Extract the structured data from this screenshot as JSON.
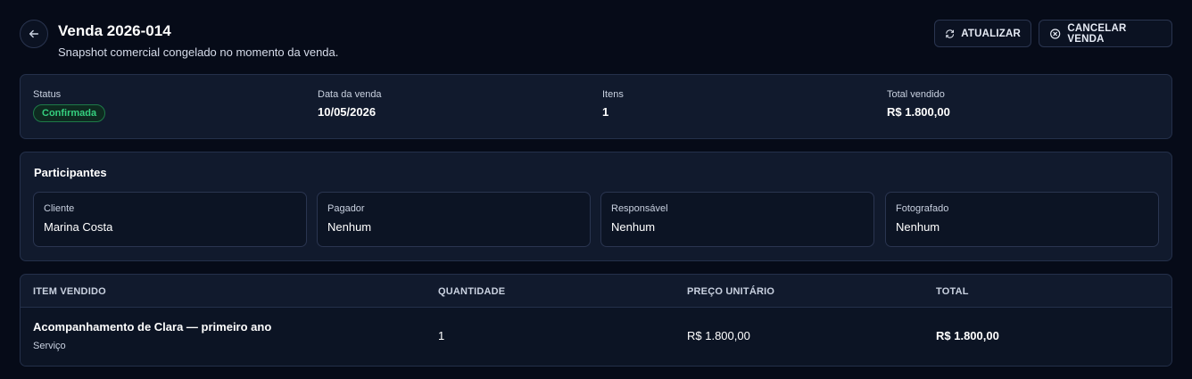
{
  "header": {
    "title": "Venda 2026-014",
    "subtitle": "Snapshot comercial congelado no momento da venda.",
    "refresh_label": "ATUALIZAR",
    "cancel_label": "CANCELAR VENDA"
  },
  "summary": {
    "status_label": "Status",
    "status_value": "Confirmada",
    "date_label": "Data da venda",
    "date_value": "10/05/2026",
    "items_label": "Itens",
    "items_value": "1",
    "total_label": "Total vendido",
    "total_value": "R$ 1.800,00"
  },
  "participants": {
    "title": "Participantes",
    "items": [
      {
        "label": "Cliente",
        "value": "Marina Costa"
      },
      {
        "label": "Pagador",
        "value": "Nenhum"
      },
      {
        "label": "Responsável",
        "value": "Nenhum"
      },
      {
        "label": "Fotografado",
        "value": "Nenhum"
      }
    ]
  },
  "table": {
    "headers": [
      "ITEM VENDIDO",
      "QUANTIDADE",
      "PREÇO UNITÁRIO",
      "TOTAL"
    ],
    "rows": [
      {
        "name": "Acompanhamento de Clara — primeiro ano",
        "type": "Serviço",
        "quantity": "1",
        "unit_price": "R$ 1.800,00",
        "total": "R$ 1.800,00"
      }
    ]
  },
  "colors": {
    "background": "#060b18",
    "card": "#111a2d",
    "status_green": "#35d07f"
  },
  "icons": {
    "back": "arrow-left-icon",
    "refresh": "refresh-icon",
    "cancel": "x-circle-icon"
  }
}
